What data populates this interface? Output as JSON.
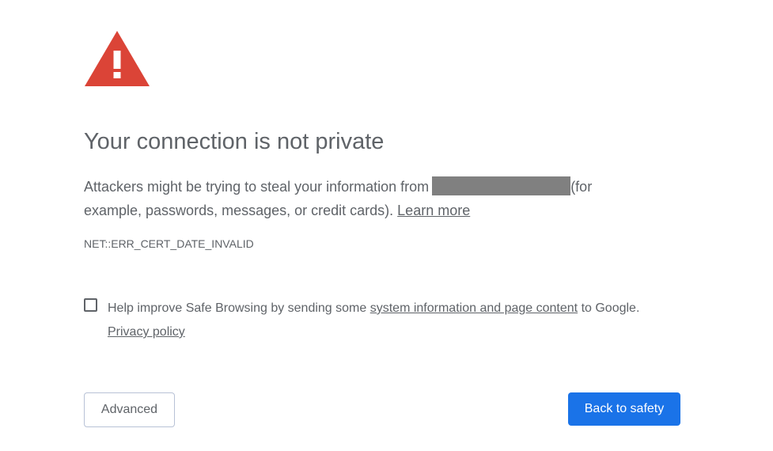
{
  "interstitial": {
    "icon": "warning-triangle-icon",
    "title": "Your connection is not private",
    "desc_before": "Attackers might be trying to steal your information from",
    "desc_after": "(for example, passwords, messages, or credit cards).",
    "learn_more": "Learn more",
    "error_code": "NET::ERR_CERT_DATE_INVALID",
    "optin_before": "Help improve Safe Browsing by sending some",
    "optin_link": "system information and page content",
    "optin_after": "to Google.",
    "privacy_link": "Privacy policy",
    "optin_checked": false,
    "advanced_label": "Advanced",
    "back_label": "Back to safety"
  },
  "colors": {
    "warning_red": "#db4437",
    "primary_blue": "#1a73e8",
    "text_gray": "#5f6368",
    "redaction_gray": "#808080"
  }
}
